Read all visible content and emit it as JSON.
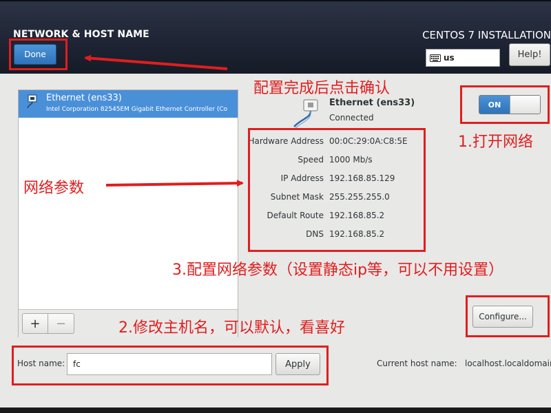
{
  "header": {
    "page_title": "NETWORK & HOST NAME",
    "install_title": "CENTOS 7 INSTALLATION",
    "done_label": "Done",
    "keyboard_layout": "us",
    "help_label": "Help!"
  },
  "device_list": {
    "devices": [
      {
        "name": "Ethernet (ens33)",
        "description": "Intel Corporation 82545EM Gigabit Ethernet Controller (Co"
      }
    ],
    "add_label": "+",
    "remove_label": "−"
  },
  "device_detail": {
    "name": "Ethernet (ens33)",
    "status": "Connected",
    "toggle_label": "ON",
    "rows": [
      {
        "label": "Hardware Address",
        "value": "00:0C:29:0A:C8:5E"
      },
      {
        "label": "Speed",
        "value": "1000 Mb/s"
      },
      {
        "label": "IP Address",
        "value": "192.168.85.129"
      },
      {
        "label": "Subnet Mask",
        "value": "255.255.255.0"
      },
      {
        "label": "Default Route",
        "value": "192.168.85.2"
      },
      {
        "label": "DNS",
        "value": "192.168.85.2"
      }
    ],
    "configure_label": "Configure..."
  },
  "hostname": {
    "label": "Host name:",
    "value": "fc",
    "apply_label": "Apply",
    "current_label": "Current host name:",
    "current_value": "localhost.localdomain"
  },
  "annotations": {
    "confirm": "配置完成后点击确认",
    "open_network": "1.打开网络",
    "network_params": "网络参数",
    "configure_params": "3.配置网络参数（设置静态ip等，可以不用设置）",
    "modify_hostname": "2.修改主机名，可以默认，看喜好",
    "color": "#e01e1e"
  },
  "colors": {
    "accent": "#4a90d9",
    "header_bg": "#1f2535",
    "annotation": "#e01e1e"
  }
}
